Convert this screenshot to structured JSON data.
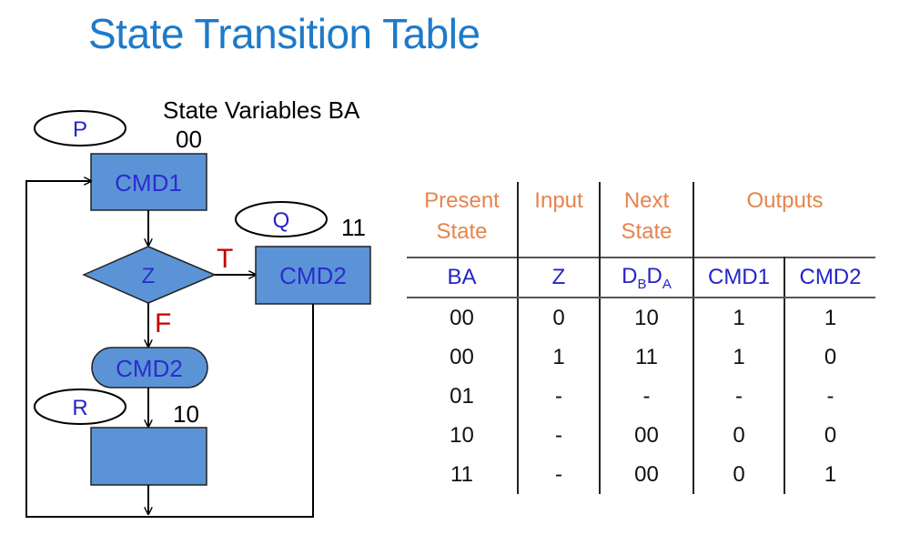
{
  "title": "State Transition Table",
  "diagram": {
    "state_vars_label": "State Variables BA",
    "states": [
      {
        "name": "P",
        "code": "00"
      },
      {
        "name": "Q",
        "code": "11"
      },
      {
        "name": "R",
        "code": "10"
      }
    ],
    "cmd1": "CMD1",
    "decision": "Z",
    "true_label": "T",
    "false_label": "F",
    "cmd2_state": "CMD2",
    "cmd2_conditional": "CMD2"
  },
  "table": {
    "header": {
      "present_l1": "Present",
      "present_l2": "State",
      "input": "Input",
      "next_l1": "Next",
      "next_l2": "State",
      "outputs": "Outputs"
    },
    "sub": {
      "ba": "BA",
      "z": "Z",
      "db_d": "D",
      "db_s": "B",
      "da_d": "D",
      "da_s": "A",
      "cmd1": "CMD1",
      "cmd2": "CMD2"
    },
    "rows": [
      [
        "00",
        "0",
        "10",
        "1",
        "1"
      ],
      [
        "00",
        "1",
        "11",
        "1",
        "0"
      ],
      [
        "01",
        "-",
        "-",
        "-",
        "-"
      ],
      [
        "10",
        "-",
        "00",
        "0",
        "0"
      ],
      [
        "11",
        "-",
        "00",
        "0",
        "1"
      ]
    ]
  },
  "colors": {
    "title": "#1f7ac8",
    "box_fill": "#5b94d6",
    "box_text": "#2c2ccf",
    "state_text": "#2424c8",
    "branch_label": "#c00000",
    "table_header": "#e5854d"
  }
}
